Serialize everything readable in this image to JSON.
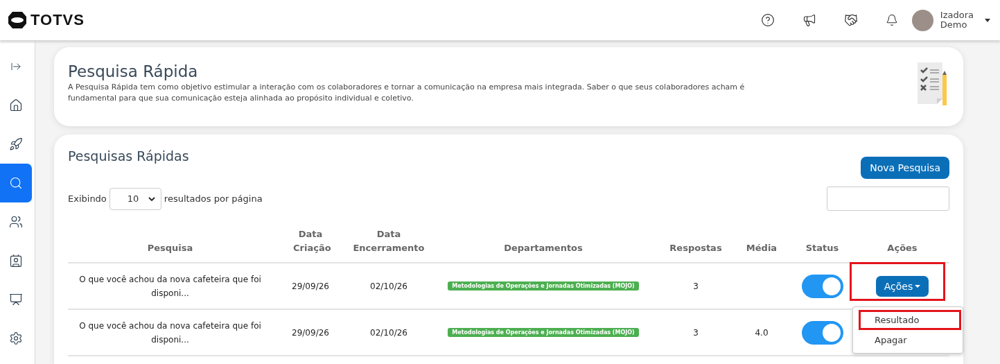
{
  "header": {
    "logo": "TOTVS",
    "user": {
      "name": "Izadora",
      "role": "Demo"
    }
  },
  "sidebar": {
    "items": [
      {
        "selected": false
      },
      {
        "selected": false
      },
      {
        "selected": false
      },
      {
        "selected": true
      },
      {
        "selected": false
      },
      {
        "selected": false
      },
      {
        "selected": false
      },
      {
        "selected": false
      }
    ]
  },
  "intro": {
    "title": "Pesquisa Rápida",
    "description": "A Pesquisa Rápida tem como objetivo estimular a interação com os colaboradores e tornar a comunicação na empresa mais integrada. Saber o que seus colaboradores acham é fundamental para que sua comunicação esteja alinhada ao propósito individual e coletivo."
  },
  "list": {
    "title": "Pesquisas Rápidas",
    "new_button": "Nova Pesquisa",
    "show_label": "Exibindo",
    "page_size": "10",
    "per_page_label": "resultados por página",
    "columns": [
      "Pesquisa",
      "Data Criação",
      "Data Encerramento",
      "Departamentos",
      "Respostas",
      "Média",
      "Status",
      "Ações"
    ],
    "rows": [
      {
        "pesquisa": "O que você achou da nova cafeteira que foi disponi...",
        "criacao": "29/09/26",
        "encerramento": "02/10/26",
        "departamento": "Metodologias de Operações e Jornadas Otimizadas (MOJO)",
        "respostas": "3",
        "status_on": true,
        "actions": "Ações",
        "highlighted": true,
        "menu": [
          {
            "label": "Resultado",
            "highlighted": true
          },
          {
            "label": "Apagar",
            "highlighted": false
          }
        ]
      },
      {
        "pesquisa": "O que você achou da nova cafeteira que foi disponi...",
        "criacao": "29/09/26",
        "encerramento": "02/10/26",
        "departamento": "Metodologias de Operações e Jornadas Otimizadas (MOJO)",
        "respostas": "3",
        "media": "4.0",
        "status_on": true
      }
    ]
  }
}
